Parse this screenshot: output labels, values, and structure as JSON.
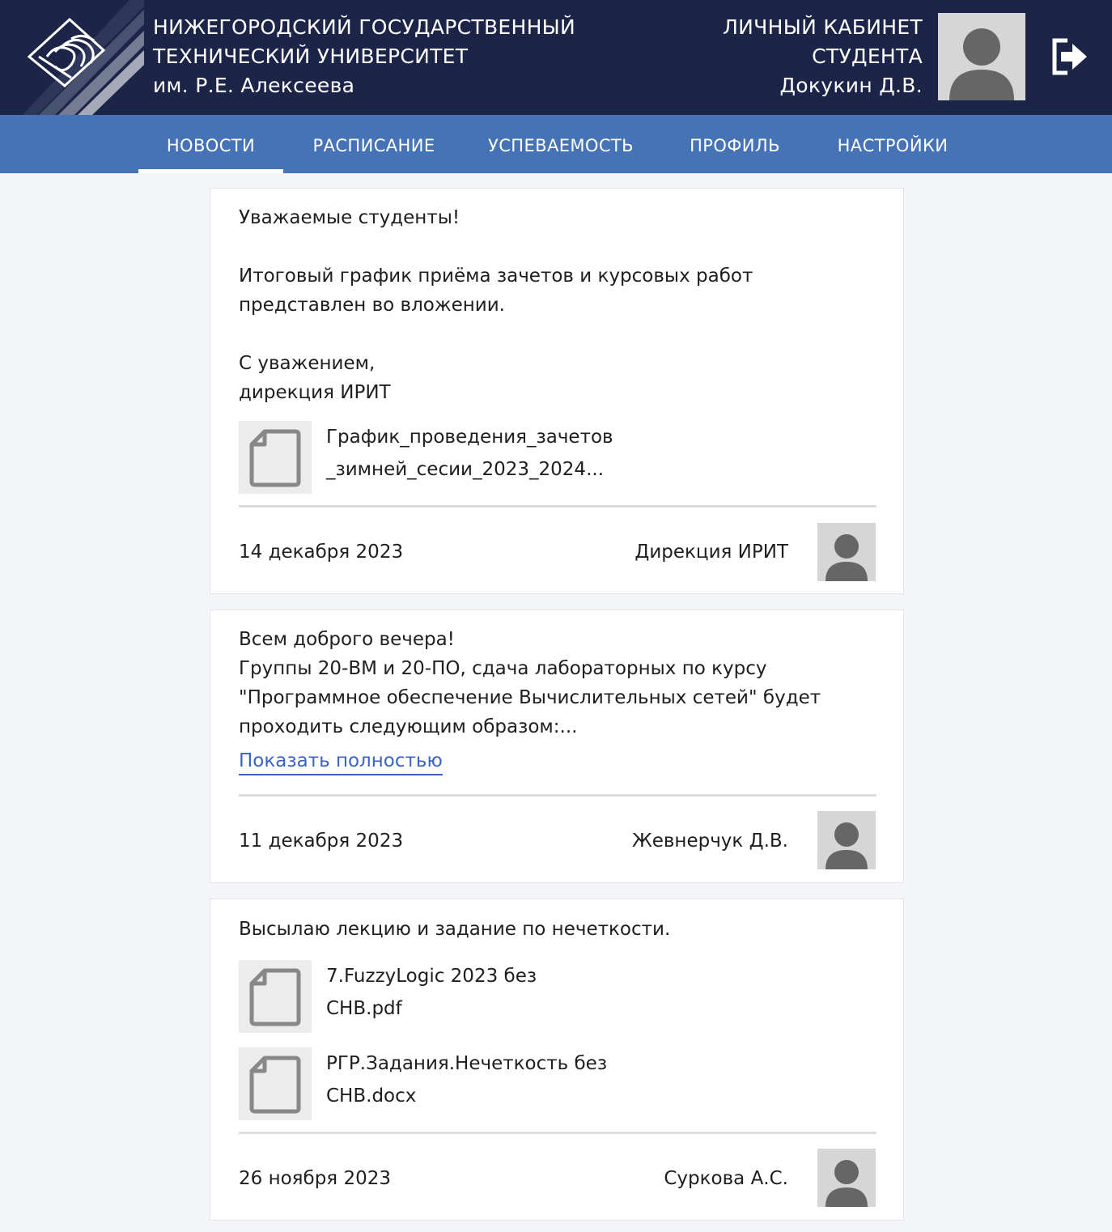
{
  "header": {
    "university": {
      "line1": "НИЖЕГОРОДСКИЙ ГОСУДАРСТВЕННЫЙ",
      "line2": "ТЕХНИЧЕСКИЙ УНИВЕРСИТЕТ",
      "line3": "им. Р.Е. Алексеева"
    },
    "cabinet": {
      "line1": "ЛИЧНЫЙ КАБИНЕТ",
      "line2": "СТУДЕНТА",
      "user": "Докукин Д.В."
    },
    "logout_icon": "logout-icon"
  },
  "nav": {
    "items": [
      {
        "label": "НОВОСТИ",
        "active": true
      },
      {
        "label": "РАСПИСАНИЕ",
        "active": false
      },
      {
        "label": "УСПЕВАЕМОСТЬ",
        "active": false
      },
      {
        "label": "ПРОФИЛЬ",
        "active": false
      },
      {
        "label": "НАСТРОЙКИ",
        "active": false
      }
    ]
  },
  "news": [
    {
      "lines": [
        "Уважаемые студенты!",
        "Итоговый график приёма зачетов и курсовых работ",
        "представлен во вложении.",
        "С уважением,",
        "дирекция ИРИТ"
      ],
      "attachments": [
        {
          "line1": "График_проведения_зачетов",
          "line2": "_зимней_сесии_2023_2024..."
        }
      ],
      "date": "14 декабря 2023",
      "author": "Дирекция ИРИТ"
    },
    {
      "lines": [
        "Всем доброго вечера!",
        "Группы 20-ВМ и 20-ПО, сдача лабораторных по курсу",
        "\"Программное обеспечение Вычислительных сетей\" будет",
        "проходить следующим образом:..."
      ],
      "more_label": "Показать полностью",
      "date": "11 декабря 2023",
      "author": "Жевнерчук Д.В."
    },
    {
      "lines": [
        "Высылаю лекцию и задание по нечеткости."
      ],
      "attachments": [
        {
          "line1": "7.FuzzyLogic 2023 без",
          "line2": "СНВ.pdf"
        },
        {
          "line1": "РГР.Задания.Нечеткость без",
          "line2": "СНВ.docx"
        }
      ],
      "date": "26 ноября 2023",
      "author": "Суркова А.С."
    }
  ],
  "colors": {
    "header_bg": "#1c2548",
    "nav_bg": "#4573b6",
    "link": "#3a63c4",
    "page_bg": "#f4f5f8"
  }
}
